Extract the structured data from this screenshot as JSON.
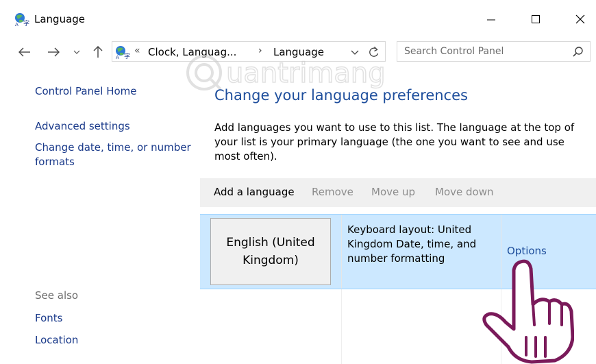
{
  "window": {
    "title": "Language",
    "icon": "language-globe-icon"
  },
  "address_bar": {
    "prefix": "«",
    "breadcrumb_parent": "Clock, Languag...",
    "separator": "›",
    "breadcrumb_current": "Language"
  },
  "search": {
    "placeholder": "Search Control Panel"
  },
  "sidebar": {
    "home": "Control Panel Home",
    "links": [
      "Advanced settings",
      "Change date, time, or number formats"
    ],
    "see_also_label": "See also",
    "see_also": [
      "Fonts",
      "Location"
    ]
  },
  "main": {
    "heading": "Change your language preferences",
    "description": "Add languages you want to use to this list. The language at the top of your list is your primary language (the one you want to see and use most often).",
    "toolbar": {
      "add": "Add a language",
      "remove": "Remove",
      "move_up": "Move up",
      "move_down": "Move down"
    },
    "languages": [
      {
        "name": "English (United Kingdom)",
        "details": "Keyboard layout: United Kingdom Date, time, and number formatting",
        "action": "Options"
      }
    ]
  },
  "colors": {
    "link": "#1a3a8a",
    "heading": "#1e4e9c",
    "selected_row": "#cce8ff",
    "toolbar_bg": "#f0f0f0",
    "disabled_text": "#8c8c8c",
    "hand_outline": "#7a1a5a"
  }
}
